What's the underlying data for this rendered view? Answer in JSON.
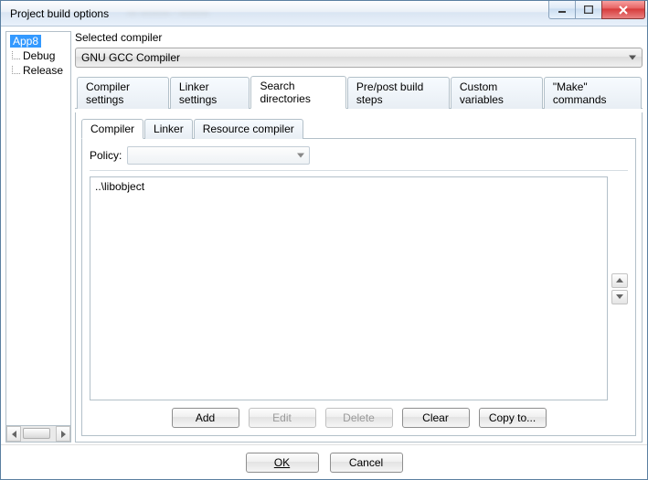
{
  "window": {
    "title": "Project build options"
  },
  "tree": {
    "root": "App8",
    "children": [
      "Debug",
      "Release"
    ]
  },
  "selectedCompiler": {
    "label": "Selected compiler",
    "value": "GNU GCC Compiler"
  },
  "outerTabs": [
    "Compiler settings",
    "Linker settings",
    "Search directories",
    "Pre/post build steps",
    "Custom variables",
    "\"Make\" commands"
  ],
  "outerActive": "Search directories",
  "innerTabs": [
    "Compiler",
    "Linker",
    "Resource compiler"
  ],
  "innerActive": "Compiler",
  "policy": {
    "label": "Policy:",
    "value": ""
  },
  "dirs": [
    "..\\libobject"
  ],
  "buttons": {
    "add": "Add",
    "edit": "Edit",
    "delete": "Delete",
    "clear": "Clear",
    "copyto": "Copy to..."
  },
  "dialog": {
    "ok": "OK",
    "cancel": "Cancel"
  }
}
